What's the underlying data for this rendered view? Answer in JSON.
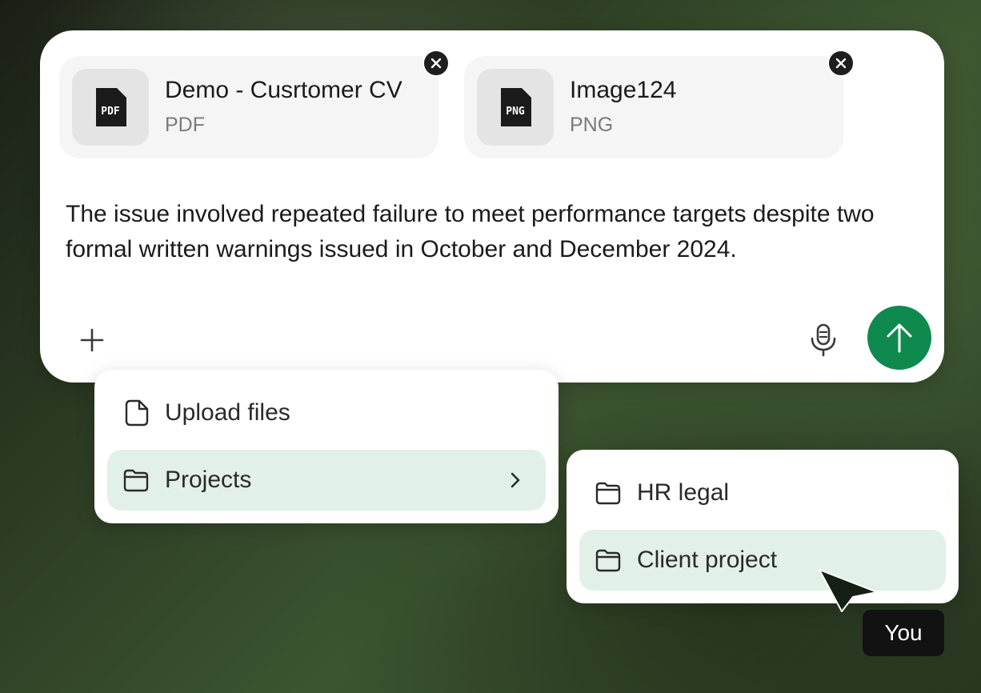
{
  "attachments": [
    {
      "name": "Demo - Cusrtomer CV",
      "type": "PDF",
      "icon_label": "PDF",
      "icon": "pdf-file-icon"
    },
    {
      "name": "Image124",
      "type": "PNG",
      "icon_label": "PNG",
      "icon": "png-file-icon"
    }
  ],
  "message": "The issue involved repeated failure to meet performance targets despite two formal written warnings issued in October and December 2024.",
  "menu": {
    "items": [
      {
        "label": "Upload files",
        "icon": "file-icon"
      },
      {
        "label": "Projects",
        "icon": "folder-icon",
        "has_submenu": true
      }
    ]
  },
  "submenu": {
    "items": [
      {
        "label": "HR legal",
        "icon": "folder-icon"
      },
      {
        "label": "Client project",
        "icon": "folder-icon"
      }
    ]
  },
  "cursor": {
    "label": "You"
  },
  "colors": {
    "accent": "#0f8a4f",
    "active_item": "#e2f1e7"
  }
}
